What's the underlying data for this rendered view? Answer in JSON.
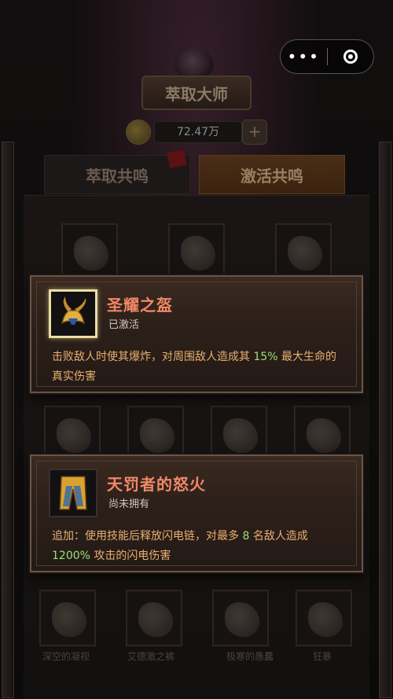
{
  "header": {
    "title": "萃取大师",
    "currency_amount": "72.47万",
    "add_icon": "plus-icon"
  },
  "menu_capsule": {
    "more_icon": "more-dots-icon",
    "close_icon": "target-icon"
  },
  "tabs": [
    {
      "label": "萃取共鸣",
      "active": false
    },
    {
      "label": "激活共鸣",
      "active": true
    }
  ],
  "bottom_labels": [
    "深空的凝视",
    "艾德激之裤",
    "极寒的愚蠢",
    "狂暴"
  ],
  "cards": [
    {
      "name": "圣耀之盔",
      "status": "已激活",
      "desc_parts": [
        "击败敌人时使其爆炸，对周围敌人造成其 ",
        "15%",
        " 最大生命的真实伤害"
      ],
      "icon": "horned-helmet-icon"
    },
    {
      "name": "天罚者的怒火",
      "status": "尚未拥有",
      "desc_parts": [
        "追加：使用技能后释放闪电链，对最多 ",
        "8",
        " 名敌人造成 ",
        "1200%",
        " 攻击的闪电伤害"
      ],
      "icon": "pants-icon"
    }
  ],
  "colors": {
    "accent_name": "#f08868",
    "highlight_number": "#9be07a",
    "desc_text": "#e8b070"
  }
}
